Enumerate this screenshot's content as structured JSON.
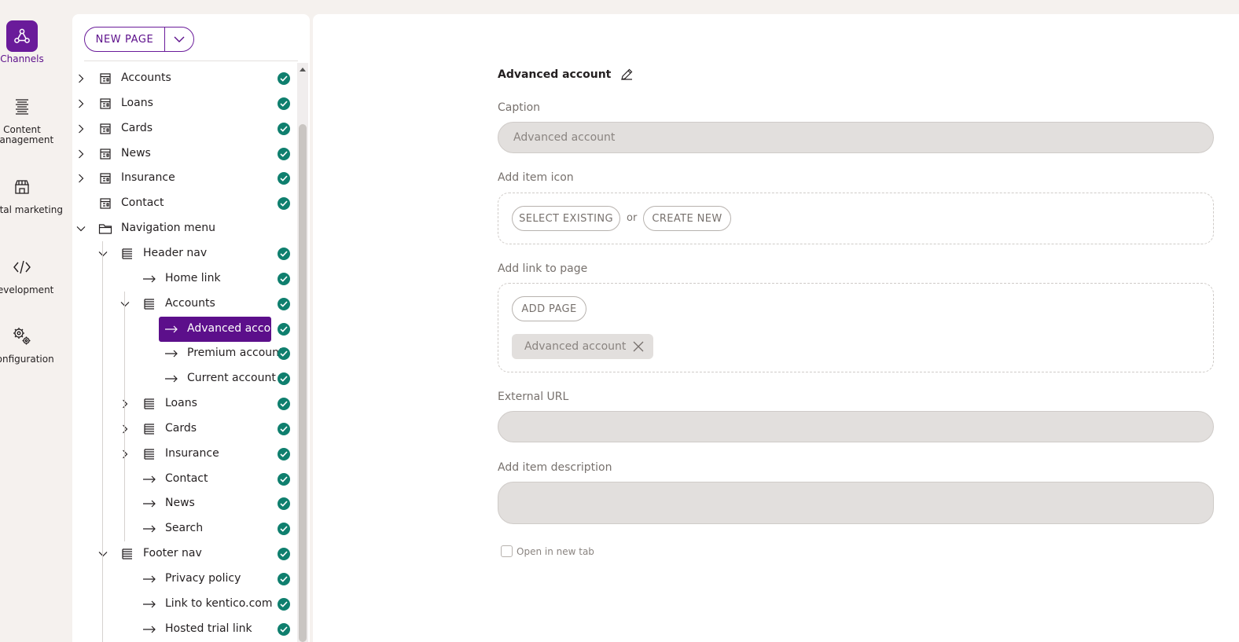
{
  "rail": {
    "items": [
      {
        "label": "Channels",
        "icon": "channels-icon"
      },
      {
        "label": "Content management",
        "icon": "content-management-icon"
      },
      {
        "label": "Digital marketing",
        "icon": "digital-marketing-icon"
      },
      {
        "label": "Development",
        "icon": "development-icon"
      },
      {
        "label": "Configuration",
        "icon": "configuration-icon"
      }
    ]
  },
  "toolbar": {
    "new_page_label": "NEW PAGE"
  },
  "tree": {
    "items": [
      {
        "label": "Accounts",
        "icon": "page-icon"
      },
      {
        "label": "Loans",
        "icon": "page-icon"
      },
      {
        "label": "Cards",
        "icon": "page-icon"
      },
      {
        "label": "News",
        "icon": "page-icon"
      },
      {
        "label": "Insurance",
        "icon": "page-icon"
      },
      {
        "label": "Contact",
        "icon": "page-icon"
      },
      {
        "label": "Navigation menu",
        "icon": "folder-icon"
      },
      {
        "label": "Header nav",
        "icon": "list-icon"
      },
      {
        "label": "Home link",
        "icon": "arrow-right-icon"
      },
      {
        "label": "Accounts",
        "icon": "list-icon"
      },
      {
        "label": "Advanced account",
        "icon": "arrow-right-icon"
      },
      {
        "label": "Premium account",
        "icon": "arrow-right-icon"
      },
      {
        "label": "Current account",
        "icon": "arrow-right-icon"
      },
      {
        "label": "Loans",
        "icon": "list-icon"
      },
      {
        "label": "Cards",
        "icon": "list-icon"
      },
      {
        "label": "Insurance",
        "icon": "list-icon"
      },
      {
        "label": "Contact",
        "icon": "arrow-right-icon"
      },
      {
        "label": "News",
        "icon": "arrow-right-icon"
      },
      {
        "label": "Search",
        "icon": "arrow-right-icon"
      },
      {
        "label": "Footer nav",
        "icon": "list-icon"
      },
      {
        "label": "Privacy policy",
        "icon": "arrow-right-icon"
      },
      {
        "label": "Link to kentico.com",
        "icon": "arrow-right-icon"
      },
      {
        "label": "Hosted trial link",
        "icon": "arrow-right-icon"
      }
    ]
  },
  "form": {
    "title": "Advanced account",
    "caption_label": "Caption",
    "caption_placeholder": "Advanced account",
    "icon_label": "Add item icon",
    "select_existing_label": "SELECT EXISTING",
    "or_text": "or",
    "create_new_label": "CREATE NEW",
    "link_label": "Add link to page",
    "add_page_label": "ADD PAGE",
    "linked_page": "Advanced account",
    "external_url_label": "External URL",
    "external_url_value": "",
    "description_label": "Add item description",
    "description_value": "",
    "open_new_tab_label": "Open in new tab"
  },
  "colors": {
    "accent": "#5c0f8b",
    "status_published": "#0f7f6e",
    "input_bg": "#e2dfdd"
  }
}
